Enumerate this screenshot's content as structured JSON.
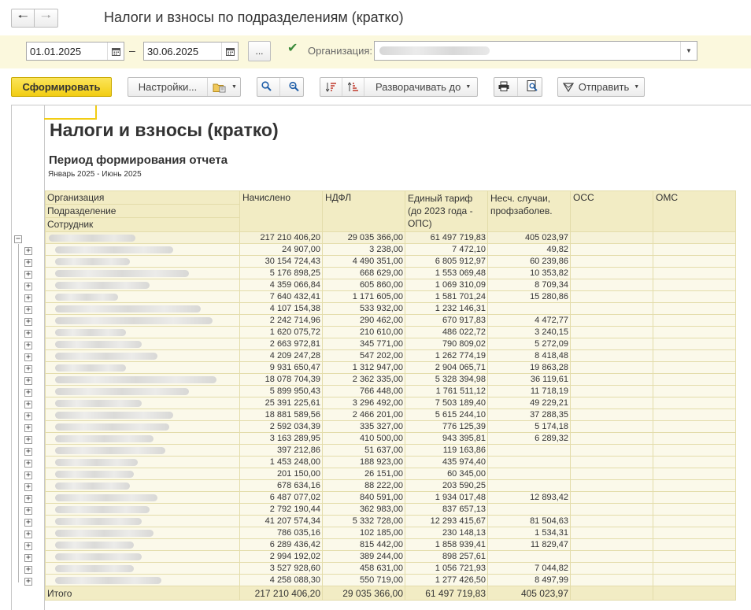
{
  "window": {
    "title": "Налоги и взносы по подразделениям (кратко)"
  },
  "params": {
    "date_from": "01.01.2025",
    "date_to": "30.06.2025",
    "dash": "–",
    "dots": "...",
    "org_label": "Организация:",
    "org_checked": true
  },
  "toolbar": {
    "generate": "Сформировать",
    "settings": "Настройки...",
    "expand_to": "Разворачивать до",
    "send": "Отправить"
  },
  "report": {
    "title": "Налоги и взносы (кратко)",
    "period_heading": "Период формирования отчета",
    "period_value": "Январь 2025 - Июнь 2025",
    "headers": {
      "org": "Организация",
      "dept": "Подразделение",
      "emp": "Сотрудник",
      "accrued": "Начислено",
      "ndfl": "НДФЛ",
      "tariff": "Единый тариф (до 2023 года - ОПС)",
      "accidents": "Несч. случаи, профзаболев.",
      "oss": "ОСС",
      "oms": "ОМС"
    },
    "org_row": {
      "accrued": "217 210 406,20",
      "ndfl": "29 035 366,00",
      "tariff": "61 497 719,83",
      "accidents": "405 023,97"
    },
    "rows": [
      {
        "accrued": "24 907,00",
        "ndfl": "3 238,00",
        "tariff": "7 472,10",
        "accidents": "49,82"
      },
      {
        "accrued": "30 154 724,43",
        "ndfl": "4 490 351,00",
        "tariff": "6 805 912,97",
        "accidents": "60 239,86"
      },
      {
        "accrued": "5 176 898,25",
        "ndfl": "668 629,00",
        "tariff": "1 553 069,48",
        "accidents": "10 353,82"
      },
      {
        "accrued": "4 359 066,84",
        "ndfl": "605 860,00",
        "tariff": "1 069 310,09",
        "accidents": "8 709,34"
      },
      {
        "accrued": "7 640 432,41",
        "ndfl": "1 171 605,00",
        "tariff": "1 581 701,24",
        "accidents": "15 280,86"
      },
      {
        "accrued": "4 107 154,38",
        "ndfl": "533 932,00",
        "tariff": "1 232 146,31",
        "accidents": ""
      },
      {
        "accrued": "2 242 714,96",
        "ndfl": "290 462,00",
        "tariff": "670 917,83",
        "accidents": "4 472,77"
      },
      {
        "accrued": "1 620 075,72",
        "ndfl": "210 610,00",
        "tariff": "486 022,72",
        "accidents": "3 240,15"
      },
      {
        "accrued": "2 663 972,81",
        "ndfl": "345 771,00",
        "tariff": "790 809,02",
        "accidents": "5 272,09"
      },
      {
        "accrued": "4 209 247,28",
        "ndfl": "547 202,00",
        "tariff": "1 262 774,19",
        "accidents": "8 418,48"
      },
      {
        "accrued": "9 931 650,47",
        "ndfl": "1 312 947,00",
        "tariff": "2 904 065,71",
        "accidents": "19 863,28"
      },
      {
        "accrued": "18 078 704,39",
        "ndfl": "2 362 335,00",
        "tariff": "5 328 394,98",
        "accidents": "36 119,61"
      },
      {
        "accrued": "5 899 950,43",
        "ndfl": "766 448,00",
        "tariff": "1 761 511,12",
        "accidents": "11 718,19"
      },
      {
        "accrued": "25 391 225,61",
        "ndfl": "3 296 492,00",
        "tariff": "7 503 189,40",
        "accidents": "49 229,21"
      },
      {
        "accrued": "18 881 589,56",
        "ndfl": "2 466 201,00",
        "tariff": "5 615 244,10",
        "accidents": "37 288,35"
      },
      {
        "accrued": "2 592 034,39",
        "ndfl": "335 327,00",
        "tariff": "776 125,39",
        "accidents": "5 174,18"
      },
      {
        "accrued": "3 163 289,95",
        "ndfl": "410 500,00",
        "tariff": "943 395,81",
        "accidents": "6 289,32"
      },
      {
        "accrued": "397 212,86",
        "ndfl": "51 637,00",
        "tariff": "119 163,86",
        "accidents": ""
      },
      {
        "accrued": "1 453 248,00",
        "ndfl": "188 923,00",
        "tariff": "435 974,40",
        "accidents": ""
      },
      {
        "accrued": "201 150,00",
        "ndfl": "26 151,00",
        "tariff": "60 345,00",
        "accidents": ""
      },
      {
        "accrued": "678 634,16",
        "ndfl": "88 222,00",
        "tariff": "203 590,25",
        "accidents": ""
      },
      {
        "accrued": "6 487 077,02",
        "ndfl": "840 591,00",
        "tariff": "1 934 017,48",
        "accidents": "12 893,42"
      },
      {
        "accrued": "2 792 190,44",
        "ndfl": "362 983,00",
        "tariff": "837 657,13",
        "accidents": ""
      },
      {
        "accrued": "41 207 574,34",
        "ndfl": "5 332 728,00",
        "tariff": "12 293 415,67",
        "accidents": "81 504,63"
      },
      {
        "accrued": "786 035,16",
        "ndfl": "102 185,00",
        "tariff": "230 148,13",
        "accidents": "1 534,31"
      },
      {
        "accrued": "6 289 436,42",
        "ndfl": "815 442,00",
        "tariff": "1 858 939,41",
        "accidents": "11 829,47"
      },
      {
        "accrued": "2 994 192,02",
        "ndfl": "389 244,00",
        "tariff": "898 257,61",
        "accidents": ""
      },
      {
        "accrued": "3 527 928,60",
        "ndfl": "458 631,00",
        "tariff": "1 056 721,93",
        "accidents": "7 044,82"
      },
      {
        "accrued": "4 258 088,30",
        "ndfl": "550 719,00",
        "tariff": "1 277 426,50",
        "accidents": "8 497,99"
      }
    ],
    "total": {
      "label": "Итого",
      "accrued": "217 210 406,20",
      "ndfl": "29 035 366,00",
      "tariff": "61 497 719,83",
      "accidents": "405 023,97"
    }
  }
}
